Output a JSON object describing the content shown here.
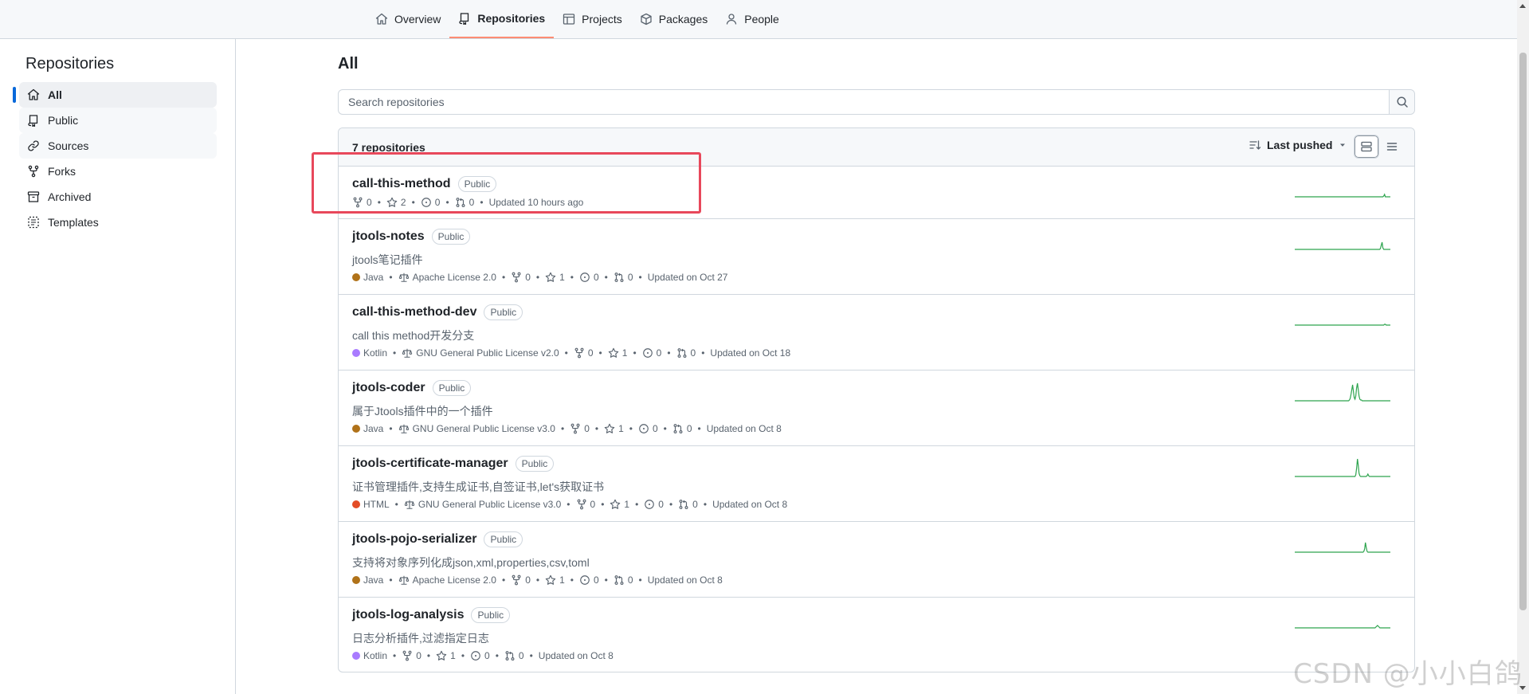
{
  "nav": {
    "tabs": [
      {
        "label": "Overview",
        "icon": "home-icon"
      },
      {
        "label": "Repositories",
        "icon": "repo-icon"
      },
      {
        "label": "Projects",
        "icon": "table-icon"
      },
      {
        "label": "Packages",
        "icon": "package-icon"
      },
      {
        "label": "People",
        "icon": "person-icon"
      }
    ],
    "active": "Repositories"
  },
  "sidebar": {
    "title": "Repositories",
    "items": [
      {
        "label": "All",
        "icon": "home-icon"
      },
      {
        "label": "Public",
        "icon": "repo-icon"
      },
      {
        "label": "Sources",
        "icon": "link-icon"
      },
      {
        "label": "Forks",
        "icon": "fork-icon"
      },
      {
        "label": "Archived",
        "icon": "archive-icon"
      },
      {
        "label": "Templates",
        "icon": "template-icon"
      }
    ],
    "active": "All"
  },
  "main": {
    "heading": "All",
    "search_placeholder": "Search repositories",
    "count_label": "7 repositories",
    "sort_label": "Last pushed"
  },
  "repos": [
    {
      "name": "call-this-method",
      "visibility": "Public",
      "description": "",
      "language": "",
      "language_color": "",
      "license": "",
      "forks": "0",
      "stars": "2",
      "issues": "0",
      "prs": "0",
      "updated": "Updated 10 hours ago",
      "activity": [
        0,
        0,
        0,
        0,
        0,
        0,
        0,
        0,
        0,
        0,
        0,
        0,
        0,
        0,
        0,
        0,
        0,
        0,
        0,
        0,
        0,
        0,
        0,
        0,
        0,
        0,
        0,
        0,
        0,
        0,
        0,
        0,
        0,
        0,
        0,
        0,
        0,
        0,
        0,
        0,
        0,
        0,
        0,
        0,
        0,
        0,
        0,
        0,
        0,
        0,
        0,
        0,
        0,
        0,
        0,
        0,
        0,
        0,
        0,
        0,
        0,
        0,
        0,
        0,
        0,
        0,
        0,
        0,
        0,
        0,
        0,
        0,
        0,
        0,
        0,
        0,
        0,
        0,
        0,
        0,
        0,
        0,
        0,
        0,
        0,
        0,
        0,
        0,
        0,
        0,
        0,
        0,
        0,
        0,
        0,
        0,
        0,
        0,
        0,
        0,
        0,
        0,
        0,
        0,
        0,
        0,
        0,
        1,
        3,
        0,
        0,
        0,
        0,
        0,
        0,
        0
      ]
    },
    {
      "name": "jtools-notes",
      "visibility": "Public",
      "description": "jtools笔记插件",
      "language": "Java",
      "language_color": "#b07219",
      "license": "Apache License 2.0",
      "forks": "0",
      "stars": "1",
      "issues": "0",
      "prs": "0",
      "updated": "Updated on Oct 27",
      "activity": [
        0,
        0,
        0,
        0,
        0,
        0,
        0,
        0,
        0,
        0,
        0,
        0,
        0,
        0,
        0,
        0,
        0,
        0,
        0,
        0,
        0,
        0,
        0,
        0,
        0,
        0,
        0,
        0,
        0,
        0,
        0,
        0,
        0,
        0,
        0,
        0,
        0,
        0,
        0,
        0,
        0,
        0,
        0,
        0,
        0,
        0,
        0,
        0,
        0,
        0,
        0,
        0,
        0,
        0,
        0,
        0,
        0,
        0,
        0,
        0,
        0,
        0,
        0,
        0,
        0,
        0,
        0,
        0,
        0,
        0,
        0,
        0,
        0,
        0,
        0,
        0,
        0,
        0,
        0,
        0,
        0,
        0,
        0,
        0,
        0,
        0,
        0,
        0,
        0,
        0,
        0,
        0,
        0,
        0,
        0,
        0,
        0,
        0,
        0,
        0,
        0,
        0,
        0,
        1,
        5,
        9,
        2,
        0,
        0,
        0,
        0,
        0,
        0,
        0,
        0,
        0
      ]
    },
    {
      "name": "call-this-method-dev",
      "visibility": "Public",
      "description": "call this method开发分支",
      "language": "Kotlin",
      "language_color": "#a97bff",
      "license": "GNU General Public License v2.0",
      "forks": "0",
      "stars": "1",
      "issues": "0",
      "prs": "0",
      "updated": "Updated on Oct 18",
      "activity": [
        0,
        0,
        0,
        0,
        0,
        0,
        0,
        0,
        0,
        0,
        0,
        0,
        0,
        0,
        0,
        0,
        0,
        0,
        0,
        0,
        0,
        0,
        0,
        0,
        0,
        0,
        0,
        0,
        0,
        0,
        0,
        0,
        0,
        0,
        0,
        0,
        0,
        0,
        0,
        0,
        0,
        0,
        0,
        0,
        0,
        0,
        0,
        0,
        0,
        0,
        0,
        0,
        0,
        0,
        0,
        0,
        0,
        0,
        0,
        0,
        0,
        0,
        0,
        0,
        0,
        0,
        0,
        0,
        0,
        0,
        0,
        0,
        0,
        0,
        0,
        0,
        0,
        0,
        0,
        0,
        0,
        0,
        0,
        0,
        0,
        0,
        0,
        0,
        0,
        0,
        0,
        0,
        0,
        0,
        0,
        0,
        0,
        0,
        0,
        0,
        0,
        0,
        0,
        0,
        0,
        0,
        0,
        0,
        1,
        1,
        0,
        0,
        0,
        0,
        0,
        0
      ]
    },
    {
      "name": "jtools-coder",
      "visibility": "Public",
      "description": "属于Jtools插件中的一个插件",
      "language": "Java",
      "language_color": "#b07219",
      "license": "GNU General Public License v3.0",
      "forks": "0",
      "stars": "1",
      "issues": "0",
      "prs": "0",
      "updated": "Updated on Oct 8",
      "activity": [
        0,
        0,
        0,
        0,
        0,
        0,
        0,
        0,
        0,
        0,
        0,
        0,
        0,
        0,
        0,
        0,
        0,
        0,
        0,
        0,
        0,
        0,
        0,
        0,
        0,
        0,
        0,
        0,
        0,
        0,
        0,
        0,
        0,
        0,
        0,
        0,
        0,
        0,
        0,
        0,
        0,
        0,
        0,
        0,
        0,
        0,
        0,
        0,
        0,
        0,
        0,
        0,
        0,
        0,
        0,
        0,
        0,
        0,
        0,
        0,
        0,
        0,
        0,
        0,
        0,
        0,
        0,
        0,
        1,
        3,
        8,
        14,
        20,
        12,
        4,
        2,
        6,
        16,
        22,
        14,
        6,
        2,
        1,
        1,
        0,
        0,
        0,
        0,
        0,
        0,
        0,
        0,
        0,
        0,
        0,
        0,
        0,
        0,
        0,
        0,
        0,
        0,
        0,
        0,
        0,
        0,
        0,
        0,
        0,
        0,
        0,
        0,
        0,
        0,
        0,
        0,
        0,
        0,
        0,
        0
      ]
    },
    {
      "name": "jtools-certificate-manager",
      "visibility": "Public",
      "description": "证书管理插件,支持生成证书,自签证书,let's获取证书",
      "language": "HTML",
      "language_color": "#e34c26",
      "license": "GNU General Public License v3.0",
      "forks": "0",
      "stars": "1",
      "issues": "0",
      "prs": "0",
      "updated": "Updated on Oct 8",
      "activity": [
        0,
        0,
        0,
        0,
        0,
        0,
        0,
        0,
        0,
        0,
        0,
        0,
        0,
        0,
        0,
        0,
        0,
        0,
        0,
        0,
        0,
        0,
        0,
        0,
        0,
        0,
        0,
        0,
        0,
        0,
        0,
        0,
        0,
        0,
        0,
        0,
        0,
        0,
        0,
        0,
        0,
        0,
        0,
        0,
        0,
        0,
        0,
        0,
        0,
        0,
        0,
        0,
        0,
        0,
        0,
        0,
        0,
        0,
        0,
        0,
        0,
        0,
        0,
        0,
        0,
        0,
        0,
        0,
        0,
        0,
        0,
        0,
        0,
        0,
        0,
        0,
        2,
        10,
        22,
        14,
        4,
        1,
        0,
        0,
        0,
        0,
        0,
        0,
        0,
        0,
        1,
        3,
        1,
        0,
        0,
        0,
        0,
        0,
        0,
        0,
        0,
        0,
        0,
        0,
        0,
        0,
        0,
        0,
        0,
        0,
        0,
        0,
        0,
        0,
        0,
        0,
        0,
        0,
        0,
        0
      ]
    },
    {
      "name": "jtools-pojo-serializer",
      "visibility": "Public",
      "description": "支持将对象序列化成json,xml,properties,csv,toml",
      "language": "Java",
      "language_color": "#b07219",
      "license": "Apache License 2.0",
      "forks": "0",
      "stars": "1",
      "issues": "0",
      "prs": "0",
      "updated": "Updated on Oct 8",
      "activity": [
        0,
        0,
        0,
        0,
        0,
        0,
        0,
        0,
        0,
        0,
        0,
        0,
        0,
        0,
        0,
        0,
        0,
        0,
        0,
        0,
        0,
        0,
        0,
        0,
        0,
        0,
        0,
        0,
        0,
        0,
        0,
        0,
        0,
        0,
        0,
        0,
        0,
        0,
        0,
        0,
        0,
        0,
        0,
        0,
        0,
        0,
        0,
        0,
        0,
        0,
        0,
        0,
        0,
        0,
        0,
        0,
        0,
        0,
        0,
        0,
        0,
        0,
        0,
        0,
        0,
        0,
        0,
        0,
        0,
        0,
        0,
        0,
        0,
        0,
        0,
        0,
        0,
        0,
        0,
        0,
        0,
        0,
        0,
        0,
        0,
        0,
        1,
        4,
        12,
        6,
        1,
        0,
        0,
        0,
        0,
        0,
        0,
        0,
        0,
        0,
        0,
        0,
        0,
        0,
        0,
        0,
        0,
        0,
        0,
        0,
        0,
        0,
        0,
        0,
        0,
        0,
        0,
        0,
        0,
        0
      ]
    },
    {
      "name": "jtools-log-analysis",
      "visibility": "Public",
      "description": "日志分析插件,过滤指定日志",
      "language": "Kotlin",
      "language_color": "#a97bff",
      "license": "",
      "forks": "0",
      "stars": "1",
      "issues": "0",
      "prs": "0",
      "updated": "Updated on Oct 8",
      "activity": [
        0,
        0,
        0,
        0,
        0,
        0,
        0,
        0,
        0,
        0,
        0,
        0,
        0,
        0,
        0,
        0,
        0,
        0,
        0,
        0,
        0,
        0,
        0,
        0,
        0,
        0,
        0,
        0,
        0,
        0,
        0,
        0,
        0,
        0,
        0,
        0,
        0,
        0,
        0,
        0,
        0,
        0,
        0,
        0,
        0,
        0,
        0,
        0,
        0,
        0,
        0,
        0,
        0,
        0,
        0,
        0,
        0,
        0,
        0,
        0,
        0,
        0,
        0,
        0,
        0,
        0,
        0,
        0,
        0,
        0,
        0,
        0,
        0,
        0,
        0,
        0,
        0,
        0,
        0,
        0,
        0,
        0,
        0,
        0,
        0,
        0,
        0,
        0,
        0,
        0,
        0,
        0,
        0,
        0,
        0,
        0,
        0,
        0,
        0,
        0,
        0,
        1,
        2,
        3,
        2,
        1,
        0,
        0,
        0,
        0,
        0,
        0,
        0,
        0,
        0,
        0,
        0,
        0,
        0,
        0
      ]
    }
  ],
  "watermark": "CSDN @小小白鸽",
  "colors": {
    "accent": "#fd8c73",
    "sparkline": "#2da44e",
    "highlight": "#e8485b",
    "link": "#0969da"
  }
}
